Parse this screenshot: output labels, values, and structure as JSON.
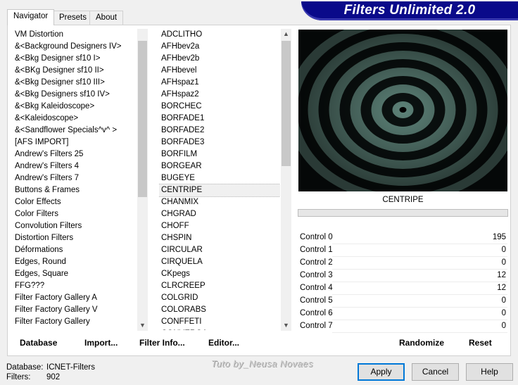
{
  "banner": {
    "title": "Filters Unlimited 2.0"
  },
  "tabs": [
    {
      "label": "Navigator"
    },
    {
      "label": "Presets"
    },
    {
      "label": "About"
    }
  ],
  "categories": [
    " VM Distortion",
    "&<Background Designers IV>",
    "&<Bkg Designer sf10 I>",
    "&<BKg Designer sf10 II>",
    "&<Bkg Designer sf10 III>",
    "&<Bkg Designers sf10 IV>",
    "&<Bkg Kaleidoscope>",
    "&<Kaleidoscope>",
    "&<Sandflower Specials^v^ >",
    "[AFS IMPORT]",
    "Andrew's Filters 25",
    "Andrew's Filters 4",
    "Andrew's Filters 7",
    "Buttons & Frames",
    "Color Effects",
    "Color Filters",
    "Convolution Filters",
    "Distortion Filters",
    "Déformations",
    "Edges, Round",
    "Edges, Square",
    "FFG???",
    "Filter Factory Gallery A",
    "Filter Factory Gallery V",
    "Filter Factory Gallery"
  ],
  "filters": [
    "ADCLITHO",
    "AFHbev2a",
    "AFHbev2b",
    "AFHbevel",
    "AFHspaz1",
    "AFHspaz2",
    "BORCHEC",
    "BORFADE1",
    "BORFADE2",
    "BORFADE3",
    "BORFILM",
    "BORGEAR",
    "BUGEYE",
    "CENTRIPE",
    "CHANMIX",
    "CHGRAD",
    "CHOFF",
    "CHSPIN",
    "CIRCULAR",
    "CIRQUELA",
    "CKpegs",
    "CLRCREEP",
    "COLGRID",
    "COLORABS",
    "CONFFETI",
    "CONVERGA"
  ],
  "selected_filter": "CENTRIPE",
  "preview": {
    "colors": {
      "light": "#5d8278",
      "dark": "#0b1211"
    }
  },
  "controls": [
    {
      "label": "Control 0",
      "value": "195"
    },
    {
      "label": "Control 1",
      "value": "0"
    },
    {
      "label": "Control 2",
      "value": "0"
    },
    {
      "label": "Control 3",
      "value": "12"
    },
    {
      "label": "Control 4",
      "value": "12"
    },
    {
      "label": "Control 5",
      "value": "0"
    },
    {
      "label": "Control 6",
      "value": "0"
    },
    {
      "label": "Control 7",
      "value": "0"
    }
  ],
  "actions": {
    "database": "Database",
    "import": "Import...",
    "filter_info": "Filter Info...",
    "editor": "Editor...",
    "randomize": "Randomize",
    "reset": "Reset"
  },
  "info": {
    "database_label": "Database:",
    "database_value": "ICNET-Filters",
    "filters_label": "Filters:",
    "filters_value": "902"
  },
  "watermark": "Tuto by_Neusa Novaes",
  "buttons": {
    "apply": "Apply",
    "cancel": "Cancel",
    "help": "Help"
  },
  "colors": {
    "banner": "#0a0a8a",
    "primary_border": "#0078d7"
  }
}
